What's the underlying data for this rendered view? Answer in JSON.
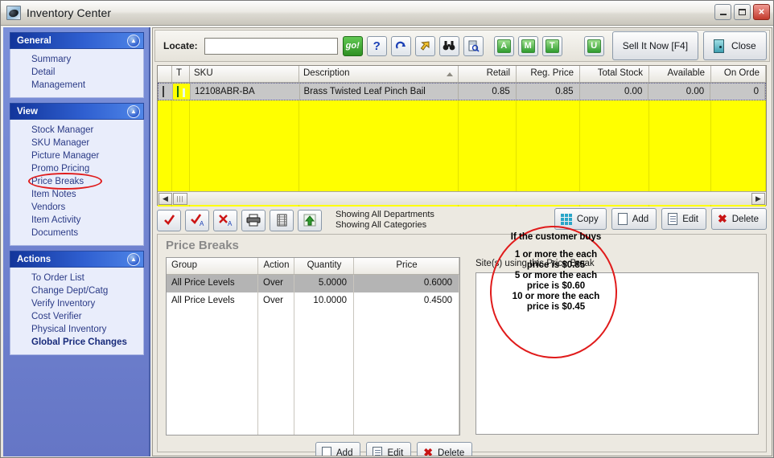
{
  "window": {
    "title": "Inventory Center",
    "icon": "app-disc-icon",
    "controls": {
      "minimize": "_",
      "maximize": "□",
      "close": "✕"
    }
  },
  "sidebar": {
    "groups": [
      {
        "title": "General",
        "items": [
          {
            "label": "Summary",
            "bold": false
          },
          {
            "label": "Detail",
            "bold": false
          },
          {
            "label": "Management",
            "bold": false
          }
        ]
      },
      {
        "title": "View",
        "items": [
          {
            "label": "Stock Manager",
            "bold": false
          },
          {
            "label": "SKU Manager",
            "bold": false
          },
          {
            "label": "Picture Manager",
            "bold": false
          },
          {
            "label": "Promo Pricing",
            "bold": false
          },
          {
            "label": "Price Breaks",
            "bold": false,
            "annotated": true
          },
          {
            "label": "Item Notes",
            "bold": false
          },
          {
            "label": "Vendors",
            "bold": false
          },
          {
            "label": "Item Activity",
            "bold": false
          },
          {
            "label": "Documents",
            "bold": false
          }
        ]
      },
      {
        "title": "Actions",
        "items": [
          {
            "label": "To Order List",
            "bold": false
          },
          {
            "label": "Change Dept/Catg",
            "bold": false
          },
          {
            "label": "Verify Inventory",
            "bold": false
          },
          {
            "label": "Cost Verifier",
            "bold": false
          },
          {
            "label": "Physical Inventory",
            "bold": false
          },
          {
            "label": "Global Price Changes",
            "bold": true
          }
        ]
      }
    ]
  },
  "locate_bar": {
    "label": "Locate:",
    "input_value": "",
    "input_placeholder": "",
    "go_label": "go!",
    "help_label": "?",
    "letter_buttons": [
      "A",
      "M",
      "T",
      "U"
    ],
    "sell_now_label": "Sell It Now [F4]",
    "close_label": "Close"
  },
  "item_grid": {
    "columns": [
      {
        "label": "",
        "align": "left"
      },
      {
        "label": "T",
        "align": "left"
      },
      {
        "label": "SKU",
        "align": "left"
      },
      {
        "label": "Description",
        "align": "left",
        "sorted": "asc"
      },
      {
        "label": "Retail",
        "align": "right"
      },
      {
        "label": "Reg. Price",
        "align": "right"
      },
      {
        "label": "Total Stock",
        "align": "right"
      },
      {
        "label": "Available",
        "align": "right"
      },
      {
        "label": "On Orde",
        "align": "right"
      }
    ],
    "rows": [
      {
        "checked": false,
        "type_badge": "I",
        "sku": "12108ABR-BA",
        "description": "Brass Twisted Leaf Pinch Bail",
        "retail": "0.85",
        "reg_price": "0.85",
        "total_stock": "0.00",
        "available": "0.00",
        "on_order": "0"
      }
    ]
  },
  "action_bar": {
    "icon_buttons": [
      "check-icon",
      "check-a-icon",
      "x-a-icon",
      "printer-icon",
      "list-icon",
      "green-up-arrow-icon"
    ],
    "status_line_1": "Showing All Departments",
    "status_line_2": "Showing All Categories",
    "buttons": [
      {
        "label": "Copy",
        "icon": "copy-grid-icon"
      },
      {
        "label": "Add",
        "icon": "page-icon"
      },
      {
        "label": "Edit",
        "icon": "page-lines-icon"
      },
      {
        "label": "Delete",
        "icon": "red-x-icon"
      }
    ]
  },
  "price_breaks": {
    "title": "Price Breaks",
    "columns": [
      "Group",
      "Action",
      "Quantity",
      "Price"
    ],
    "rows": [
      {
        "group": "All Price Levels",
        "action": "Over",
        "quantity": "5.0000",
        "price": "0.6000",
        "selected": true
      },
      {
        "group": "All Price Levels",
        "action": "Over",
        "quantity": "10.0000",
        "price": "0.4500",
        "selected": false
      }
    ],
    "sites_label": "Site(s) using this Price Break",
    "footer_buttons": [
      {
        "label": "Add",
        "icon": "page-icon"
      },
      {
        "label": "Edit",
        "icon": "page-lines-icon"
      },
      {
        "label": "Delete",
        "icon": "red-x-icon"
      }
    ]
  },
  "annotation": {
    "color": "#e01b1b",
    "heading": "If the customer buys",
    "lines": [
      "1 or more the each",
      "price is $0.85",
      "5 or more the each",
      "price is $0.60",
      "10 or more the each",
      "price is $0.45"
    ]
  }
}
